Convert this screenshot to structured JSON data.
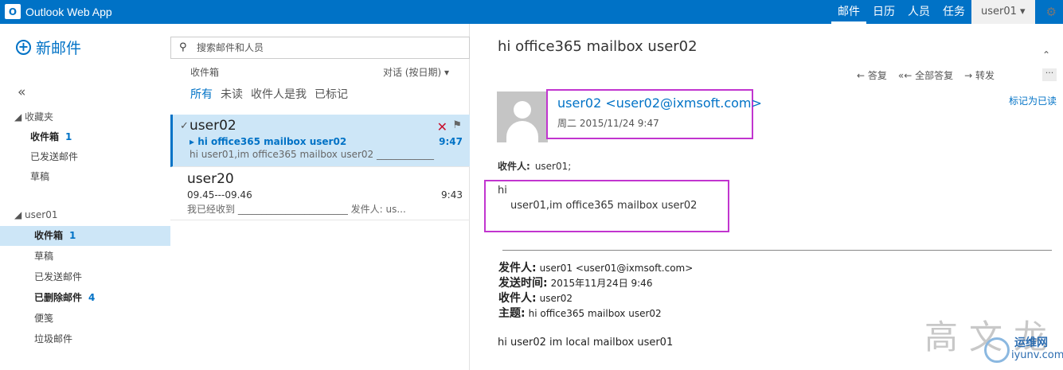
{
  "app": {
    "title": "Outlook Web App",
    "logo_letter": "O"
  },
  "topnav": {
    "mail": "邮件",
    "calendar": "日历",
    "people": "人员",
    "tasks": "任务"
  },
  "user_menu": {
    "label": "user01 ▾"
  },
  "gear_icon": "⚙",
  "left": {
    "new_mail": "新邮件",
    "collapse": "«",
    "favorites": "◢ 收藏夹",
    "fav_items": [
      {
        "label": "收件箱",
        "count": "1"
      },
      {
        "label": "已发送邮件"
      },
      {
        "label": "草稿"
      }
    ],
    "account": "◢ user01",
    "acct_items": [
      {
        "label": "收件箱",
        "count": "1"
      },
      {
        "label": "草稿"
      },
      {
        "label": "已发送邮件"
      },
      {
        "label": "已删除邮件",
        "count": "4"
      },
      {
        "label": "便笺"
      },
      {
        "label": "垃圾邮件"
      }
    ]
  },
  "middle": {
    "search_placeholder": "搜索邮件和人员",
    "search_icon": "⚲",
    "inbox": "收件箱",
    "sort": "对话 (按日期)  ▾",
    "filters": [
      "所有",
      "未读",
      "收件人是我",
      "已标记"
    ],
    "messages": [
      {
        "from": "user02",
        "check": "✓",
        "subject": "▸ hi office365 mailbox user02",
        "time": "9:47",
        "preview": "hi  user01,im office365 mailbox user02    ____________",
        "delete": "✕",
        "flag": "⚑"
      },
      {
        "from": "user20",
        "subject": "09.45---09.46",
        "time": "9:43",
        "preview": "我已经收到   _______________________   发件人: us..."
      }
    ]
  },
  "reading": {
    "subject": "hi office365 mailbox user02",
    "collapse": "⌃",
    "reply": "答复",
    "reply_all": "全部答复",
    "forward": "转发",
    "reply_icon": "←",
    "reply_all_icon": "«←",
    "forward_icon": "→",
    "more": "···",
    "sender": "user02  <user02@ixmsoft.com>",
    "sent_date": "周二 2015/11/24 9:47",
    "mark_read": "标记为已读",
    "to_label": "收件人:",
    "to_value": "user01;",
    "body_greeting": "hi",
    "body_text": "user01,im office365 mailbox user02",
    "quote": {
      "from_label": "发件人:",
      "from_value": "user01 <user01@ixmsoft.com>",
      "sent_label": "发送时间:",
      "sent_value": "2015年11月24日 9:46",
      "to_label": "收件人:",
      "to_value": "user02",
      "subject_label": "主题:",
      "subject_value": "hi office365 mailbox user02"
    },
    "quote_body": "hi  user02     im local mailbox user01"
  },
  "watermark": {
    "chars": "高文龙",
    "top": "运维网",
    "bottom": "iyunv.com"
  },
  "colors": {
    "brand": "#0072c6",
    "highlight": "#c135cf",
    "selected": "#cde6f7"
  }
}
